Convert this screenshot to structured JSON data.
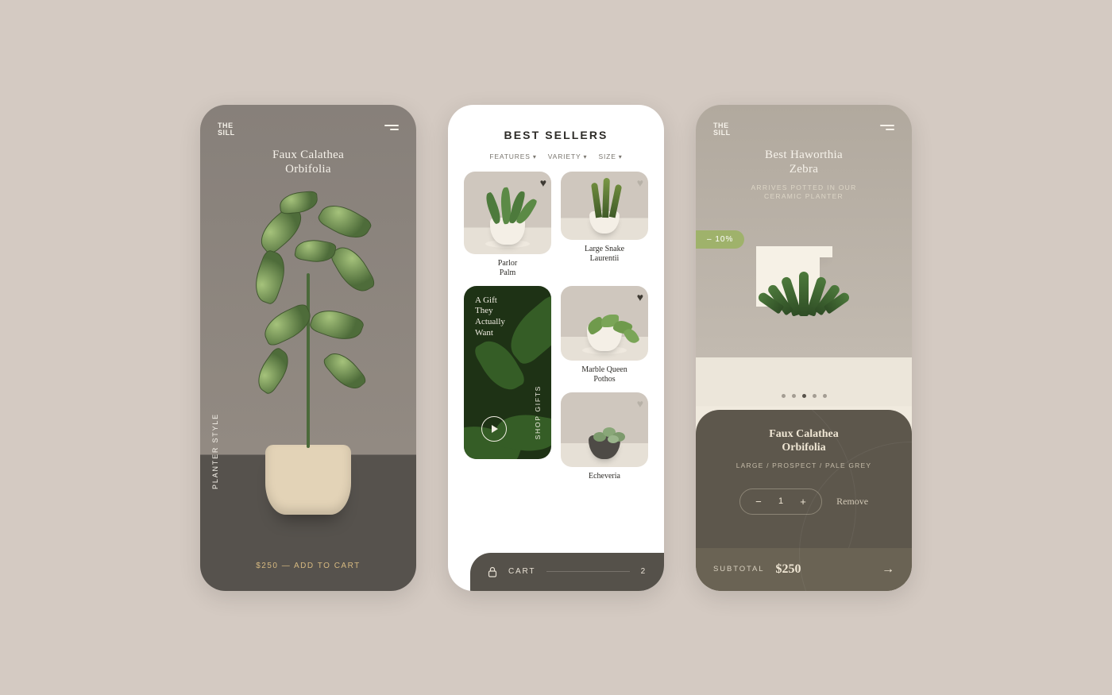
{
  "brand": {
    "line1": "THE",
    "line2": "SILL"
  },
  "screen1": {
    "title_l1": "Faux Calathea",
    "title_l2": "Orbifolia",
    "side_label": "PLANTER STYLE",
    "price": "$250",
    "cta_suffix": " — ADD TO CART"
  },
  "screen2": {
    "heading": "BEST SELLERS",
    "filters": [
      "FEATURES",
      "VARIETY",
      "SIZE"
    ],
    "products": [
      {
        "name_l1": "Parlor",
        "name_l2": "Palm"
      },
      {
        "name_l1": "Large Snake",
        "name_l2": "Laurentii"
      },
      {
        "name_l1": "Marble Queen",
        "name_l2": "Pothos"
      },
      {
        "name_l1": "Echeveria",
        "name_l2": ""
      }
    ],
    "gift": {
      "text_l1": "A Gift",
      "text_l2": "They",
      "text_l3": "Actually",
      "text_l4": "Want",
      "cta": "SHOP GIFTS"
    },
    "cart": {
      "label": "CART",
      "count": "2"
    }
  },
  "screen3": {
    "title_l1": "Best Haworthia",
    "title_l2": "Zebra",
    "subtitle_l1": "ARRIVES POTTED IN OUR",
    "subtitle_l2": "CERAMIC PLANTER",
    "discount": "– 10%",
    "cart_item": {
      "name_l1": "Faux Calathea",
      "name_l2": "Orbifolia",
      "variant": "LARGE / PROSPECT / PALE GREY",
      "qty": "1",
      "remove": "Remove"
    },
    "subtotal": {
      "label": "SUBTOTAL",
      "amount": "$250"
    }
  }
}
